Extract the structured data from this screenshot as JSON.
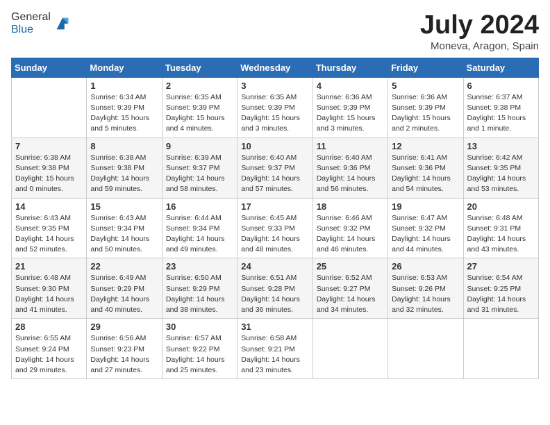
{
  "header": {
    "logo_general": "General",
    "logo_blue": "Blue",
    "month_title": "July 2024",
    "location": "Moneva, Aragon, Spain"
  },
  "days_of_week": [
    "Sunday",
    "Monday",
    "Tuesday",
    "Wednesday",
    "Thursday",
    "Friday",
    "Saturday"
  ],
  "weeks": [
    [
      {
        "day": "",
        "info": ""
      },
      {
        "day": "1",
        "info": "Sunrise: 6:34 AM\nSunset: 9:39 PM\nDaylight: 15 hours\nand 5 minutes."
      },
      {
        "day": "2",
        "info": "Sunrise: 6:35 AM\nSunset: 9:39 PM\nDaylight: 15 hours\nand 4 minutes."
      },
      {
        "day": "3",
        "info": "Sunrise: 6:35 AM\nSunset: 9:39 PM\nDaylight: 15 hours\nand 3 minutes."
      },
      {
        "day": "4",
        "info": "Sunrise: 6:36 AM\nSunset: 9:39 PM\nDaylight: 15 hours\nand 3 minutes."
      },
      {
        "day": "5",
        "info": "Sunrise: 6:36 AM\nSunset: 9:39 PM\nDaylight: 15 hours\nand 2 minutes."
      },
      {
        "day": "6",
        "info": "Sunrise: 6:37 AM\nSunset: 9:38 PM\nDaylight: 15 hours\nand 1 minute."
      }
    ],
    [
      {
        "day": "7",
        "info": "Sunrise: 6:38 AM\nSunset: 9:38 PM\nDaylight: 15 hours\nand 0 minutes."
      },
      {
        "day": "8",
        "info": "Sunrise: 6:38 AM\nSunset: 9:38 PM\nDaylight: 14 hours\nand 59 minutes."
      },
      {
        "day": "9",
        "info": "Sunrise: 6:39 AM\nSunset: 9:37 PM\nDaylight: 14 hours\nand 58 minutes."
      },
      {
        "day": "10",
        "info": "Sunrise: 6:40 AM\nSunset: 9:37 PM\nDaylight: 14 hours\nand 57 minutes."
      },
      {
        "day": "11",
        "info": "Sunrise: 6:40 AM\nSunset: 9:36 PM\nDaylight: 14 hours\nand 56 minutes."
      },
      {
        "day": "12",
        "info": "Sunrise: 6:41 AM\nSunset: 9:36 PM\nDaylight: 14 hours\nand 54 minutes."
      },
      {
        "day": "13",
        "info": "Sunrise: 6:42 AM\nSunset: 9:35 PM\nDaylight: 14 hours\nand 53 minutes."
      }
    ],
    [
      {
        "day": "14",
        "info": "Sunrise: 6:43 AM\nSunset: 9:35 PM\nDaylight: 14 hours\nand 52 minutes."
      },
      {
        "day": "15",
        "info": "Sunrise: 6:43 AM\nSunset: 9:34 PM\nDaylight: 14 hours\nand 50 minutes."
      },
      {
        "day": "16",
        "info": "Sunrise: 6:44 AM\nSunset: 9:34 PM\nDaylight: 14 hours\nand 49 minutes."
      },
      {
        "day": "17",
        "info": "Sunrise: 6:45 AM\nSunset: 9:33 PM\nDaylight: 14 hours\nand 48 minutes."
      },
      {
        "day": "18",
        "info": "Sunrise: 6:46 AM\nSunset: 9:32 PM\nDaylight: 14 hours\nand 46 minutes."
      },
      {
        "day": "19",
        "info": "Sunrise: 6:47 AM\nSunset: 9:32 PM\nDaylight: 14 hours\nand 44 minutes."
      },
      {
        "day": "20",
        "info": "Sunrise: 6:48 AM\nSunset: 9:31 PM\nDaylight: 14 hours\nand 43 minutes."
      }
    ],
    [
      {
        "day": "21",
        "info": "Sunrise: 6:48 AM\nSunset: 9:30 PM\nDaylight: 14 hours\nand 41 minutes."
      },
      {
        "day": "22",
        "info": "Sunrise: 6:49 AM\nSunset: 9:29 PM\nDaylight: 14 hours\nand 40 minutes."
      },
      {
        "day": "23",
        "info": "Sunrise: 6:50 AM\nSunset: 9:29 PM\nDaylight: 14 hours\nand 38 minutes."
      },
      {
        "day": "24",
        "info": "Sunrise: 6:51 AM\nSunset: 9:28 PM\nDaylight: 14 hours\nand 36 minutes."
      },
      {
        "day": "25",
        "info": "Sunrise: 6:52 AM\nSunset: 9:27 PM\nDaylight: 14 hours\nand 34 minutes."
      },
      {
        "day": "26",
        "info": "Sunrise: 6:53 AM\nSunset: 9:26 PM\nDaylight: 14 hours\nand 32 minutes."
      },
      {
        "day": "27",
        "info": "Sunrise: 6:54 AM\nSunset: 9:25 PM\nDaylight: 14 hours\nand 31 minutes."
      }
    ],
    [
      {
        "day": "28",
        "info": "Sunrise: 6:55 AM\nSunset: 9:24 PM\nDaylight: 14 hours\nand 29 minutes."
      },
      {
        "day": "29",
        "info": "Sunrise: 6:56 AM\nSunset: 9:23 PM\nDaylight: 14 hours\nand 27 minutes."
      },
      {
        "day": "30",
        "info": "Sunrise: 6:57 AM\nSunset: 9:22 PM\nDaylight: 14 hours\nand 25 minutes."
      },
      {
        "day": "31",
        "info": "Sunrise: 6:58 AM\nSunset: 9:21 PM\nDaylight: 14 hours\nand 23 minutes."
      },
      {
        "day": "",
        "info": ""
      },
      {
        "day": "",
        "info": ""
      },
      {
        "day": "",
        "info": ""
      }
    ]
  ]
}
